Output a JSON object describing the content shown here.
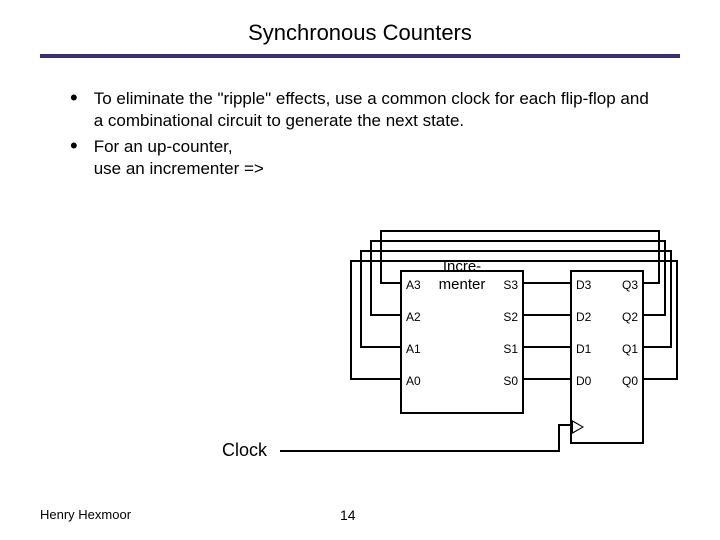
{
  "title": "Synchronous Counters",
  "bullets": [
    "To eliminate the \"ripple\" effects, use a common clock for each flip-flop and a combinational circuit to generate the next state.",
    "For an up-counter,\nuse an incrementer =>"
  ],
  "diagram": {
    "incrementer_label_top": "Incre-",
    "incrementer_label_bot": "menter",
    "a_ports": [
      "A3",
      "A2",
      "A1",
      "A0"
    ],
    "s_ports": [
      "S3",
      "S2",
      "S1",
      "S0"
    ],
    "d_ports": [
      "D3",
      "D2",
      "D1",
      "D0"
    ],
    "q_ports": [
      "Q3",
      "Q2",
      "Q1",
      "Q0"
    ],
    "clock_label": "Clock"
  },
  "footer": {
    "author": "Henry Hexmoor",
    "page": "14"
  }
}
